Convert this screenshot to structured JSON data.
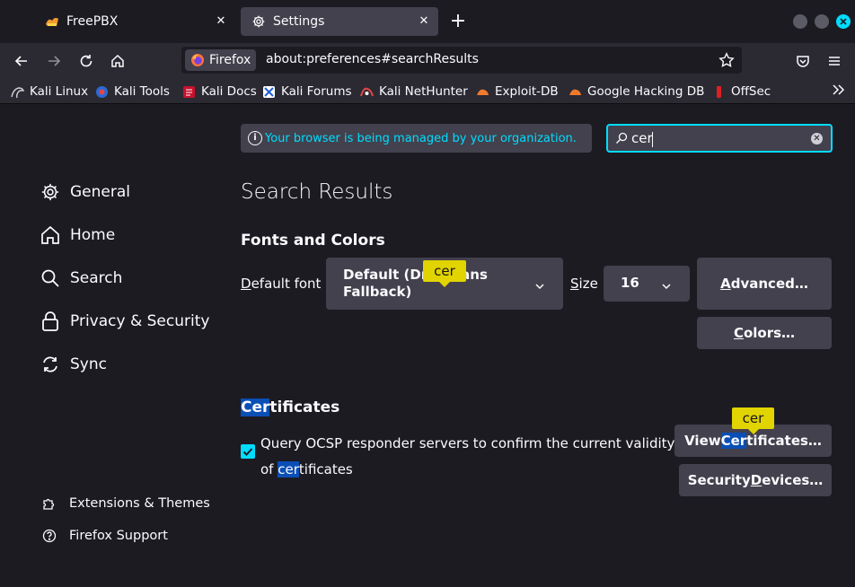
{
  "tabs": [
    {
      "title": "FreePBX",
      "icon": "freepbx-icon"
    },
    {
      "title": "Settings",
      "icon": "gear-icon",
      "active": true
    }
  ],
  "toolbar": {
    "identity_label": "Firefox",
    "url": "about:preferences#searchResults"
  },
  "bookmarks": [
    {
      "label": "Kali Linux",
      "icon": "kali-dragon-icon"
    },
    {
      "label": "Kali Tools",
      "icon": "kali-tools-icon"
    },
    {
      "label": "Kali Docs",
      "icon": "kali-docs-icon"
    },
    {
      "label": "Kali Forums",
      "icon": "kali-forums-icon"
    },
    {
      "label": "Kali NetHunter",
      "icon": "nethunter-icon"
    },
    {
      "label": "Exploit-DB",
      "icon": "exploit-db-icon"
    },
    {
      "label": "Google Hacking DB",
      "icon": "ghdb-icon"
    },
    {
      "label": "OffSec",
      "icon": "offsec-icon"
    }
  ],
  "banner": {
    "text": "Your browser is being managed by your organization."
  },
  "search": {
    "value": "cer"
  },
  "sidebar": {
    "categories": [
      {
        "label": "General",
        "icon": "gear-icon"
      },
      {
        "label": "Home",
        "icon": "home-icon"
      },
      {
        "label": "Search",
        "icon": "search-icon"
      },
      {
        "label": "Privacy & Security",
        "icon": "lock-icon"
      },
      {
        "label": "Sync",
        "icon": "sync-icon"
      }
    ],
    "footer": [
      {
        "label": "Extensions & Themes",
        "icon": "puzzle-icon"
      },
      {
        "label": "Firefox Support",
        "icon": "help-icon"
      }
    ]
  },
  "main": {
    "title": "Search Results",
    "fonts": {
      "heading": "Fonts and Colors",
      "default_font_label_first": "D",
      "default_font_label_rest": "efault font",
      "font_value_line1": "Default (DroidSans",
      "font_value_line2": "Fallback)",
      "size_label_first": "S",
      "size_label_rest": "ize",
      "size_value": "16",
      "advanced_first": "A",
      "advanced_rest": "dvanced…",
      "colors_first": "C",
      "colors_rest": "olors…"
    },
    "certificates": {
      "heading_hl": "Cer",
      "heading_rest": "tificates",
      "ocsp_text": "Query OCSP responder servers to confirm the current validity of ",
      "ocsp_hl": "cer",
      "ocsp_rest": "tificates",
      "ocsp_checked": true,
      "view_prefix": "View ",
      "view_hl": "Cer",
      "view_rest": "tificates…",
      "devices_prefix": "Security ",
      "devices_ul": "D",
      "devices_rest": "evices…"
    },
    "match_badge": "cer"
  },
  "colors": {
    "accent": "#00ddff",
    "highlight": "#0a4fb6",
    "match_badge": "#e1d400",
    "background": "#1c1b22",
    "button": "#42414d"
  }
}
